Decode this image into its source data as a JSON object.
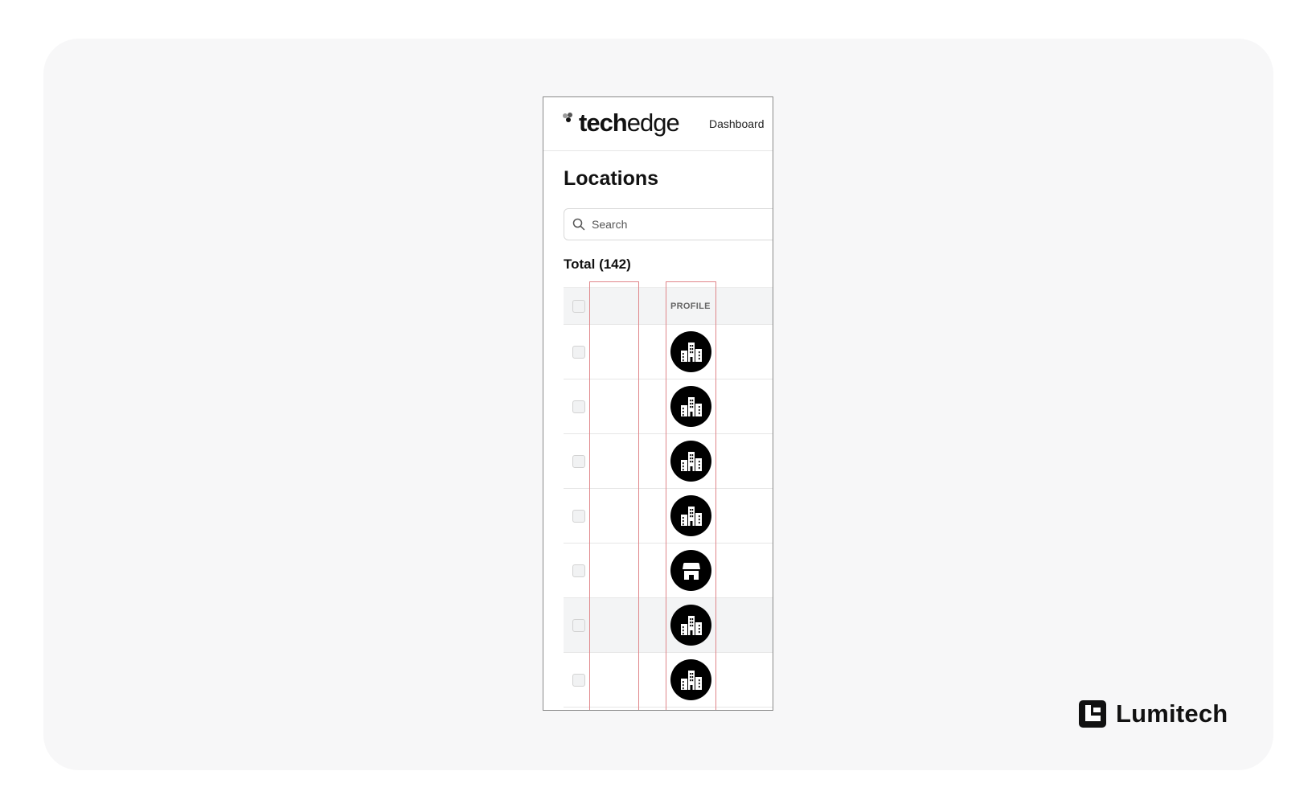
{
  "header": {
    "logo_bold": "tech",
    "logo_light": "edge",
    "nav_link": "Dashboard"
  },
  "page": {
    "title": "Locations",
    "total_label": "Total (142)"
  },
  "search": {
    "placeholder": "Search",
    "value": ""
  },
  "table": {
    "columns": [
      "",
      "",
      "PROFILE"
    ],
    "rows": [
      {
        "icon": "building-icon",
        "highlighted": false
      },
      {
        "icon": "building-icon",
        "highlighted": false
      },
      {
        "icon": "building-icon",
        "highlighted": false
      },
      {
        "icon": "building-icon",
        "highlighted": false
      },
      {
        "icon": "store-icon",
        "highlighted": false
      },
      {
        "icon": "building-icon",
        "highlighted": true
      },
      {
        "icon": "building-icon",
        "highlighted": false
      }
    ]
  },
  "annotation_color": "#e0868a",
  "brand": {
    "name": "Lumitech"
  }
}
